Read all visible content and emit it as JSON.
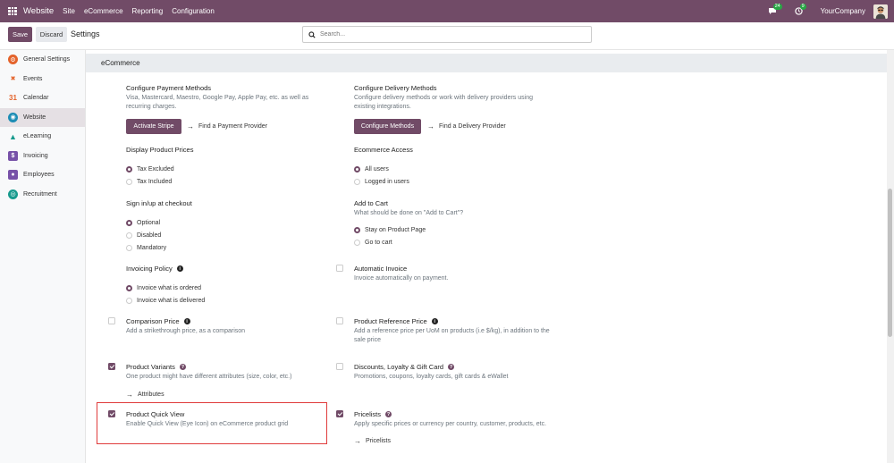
{
  "topbar": {
    "app_name": "Website",
    "menu": [
      "Site",
      "eCommerce",
      "Reporting",
      "Configuration"
    ],
    "messages_badge": "24",
    "activity_badge": "9",
    "company": "YourCompany"
  },
  "control": {
    "save_label": "Save",
    "discard_label": "Discard",
    "title": "Settings",
    "search_placeholder": "Search..."
  },
  "sidebar": {
    "items": [
      {
        "label": "General Settings",
        "icon": "settings-icon",
        "color": "#e4632b"
      },
      {
        "label": "Events",
        "icon": "events-icon",
        "color": "#e4632b"
      },
      {
        "label": "Calendar",
        "icon": "calendar-icon",
        "color": "#e4632b"
      },
      {
        "label": "Website",
        "icon": "website-icon",
        "color": "#1d8db5"
      },
      {
        "label": "eLearning",
        "icon": "elearning-icon",
        "color": "#179a8d"
      },
      {
        "label": "Invoicing",
        "icon": "invoicing-icon",
        "color": "#7752a8"
      },
      {
        "label": "Employees",
        "icon": "employees-icon",
        "color": "#7752a8"
      },
      {
        "label": "Recruitment",
        "icon": "recruitment-icon",
        "color": "#179a8d"
      }
    ]
  },
  "section": {
    "title": "eCommerce"
  },
  "settings": {
    "payment": {
      "title": "Configure Payment Methods",
      "desc": "Visa, Mastercard, Maestro, Google Pay, Apple Pay, etc. as well as recurring charges.",
      "button": "Activate Stripe",
      "link": "Find a Payment Provider"
    },
    "delivery": {
      "title": "Configure Delivery Methods",
      "desc": "Configure delivery methods or work with delivery providers using existing integrations.",
      "button": "Configure Methods",
      "link": "Find a Delivery Provider"
    },
    "prices": {
      "title": "Display Product Prices",
      "options": [
        "Tax Excluded",
        "Tax Included"
      ],
      "selected": "Tax Excluded"
    },
    "access": {
      "title": "Ecommerce Access",
      "options": [
        "All users",
        "Logged in users"
      ],
      "selected": "All users"
    },
    "signin": {
      "title": "Sign in/up at checkout",
      "options": [
        "Optional",
        "Disabled",
        "Mandatory"
      ],
      "selected": "Optional"
    },
    "cart": {
      "title": "Add to Cart",
      "desc": "What should be done on \"Add to Cart\"?",
      "options": [
        "Stay on Product Page",
        "Go to cart"
      ],
      "selected": "Stay on Product Page"
    },
    "invoicing_policy": {
      "title": "Invoicing Policy",
      "options": [
        "Invoice what is ordered",
        "Invoice what is delivered"
      ],
      "selected": "Invoice what is ordered"
    },
    "auto_invoice": {
      "title": "Automatic Invoice",
      "desc": "Invoice automatically on payment.",
      "checked": false
    },
    "comparison_price": {
      "title": "Comparison Price",
      "desc": "Add a strikethrough price, as a comparison",
      "checked": false
    },
    "reference_price": {
      "title": "Product Reference Price",
      "desc": "Add a reference price per UoM on products (i.e $/kg), in addition to the sale price",
      "checked": false
    },
    "variants": {
      "title": "Product Variants",
      "desc": "One product might have different attributes (size, color, etc.)",
      "link": "Attributes",
      "checked": true
    },
    "discounts": {
      "title": "Discounts, Loyalty & Gift Card",
      "desc": "Promotions, coupons, loyalty cards, gift cards & eWallet",
      "checked": false
    },
    "quick_view": {
      "title": "Product Quick View",
      "desc": "Enable Quick View (Eye Icon) on eCommerce product grid",
      "checked": true
    },
    "pricelists": {
      "title": "Pricelists",
      "desc": "Apply specific prices or currency per country, customer, products, etc.",
      "link": "Pricelists",
      "checked": true
    }
  }
}
